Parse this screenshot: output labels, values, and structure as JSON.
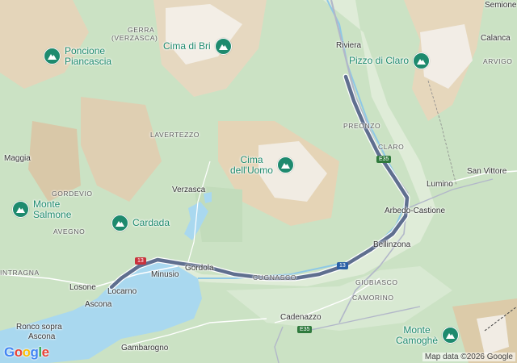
{
  "map": {
    "places": {
      "gerra": "GERRA",
      "gerra_sub": "(VERZASCA)",
      "riviera": "Riviera",
      "calanca": "Calanca",
      "arvigo": "ARVIGO",
      "lavertezzo": "LAVERTEZZO",
      "preonzo": "PREONZO",
      "claro": "CLARO",
      "maggia": "Maggia",
      "gordevio": "GORDEVIO",
      "verzasca": "Verzasca",
      "lumino": "Lumino",
      "san_vittore": "San Vittore",
      "arbedo": "Arbedo-Castione",
      "avegno": "AVEGNO",
      "bellinzona": "Bellinzona",
      "intragna": "INTRAGNA",
      "minusio": "Minusio",
      "gordola": "Gordola",
      "cugnasco": "CUGNASCO",
      "losone": "Losone",
      "locarno": "Locarno",
      "giubiasco": "GIUBIASCO",
      "ascona": "Ascona",
      "camorino": "CAMORINO",
      "cadenazzo": "Cadenazzo",
      "ronco1": "Ronco sopra",
      "ronco2": "Ascona",
      "gambarogno": "Gambarogno",
      "top_right": "Semione"
    },
    "peaks": {
      "ponciana1": "Poncione",
      "ponciana2": "Piancascia",
      "cima_bri": "Cima di Bri",
      "pizzo_claro": "Pizzo di Claro",
      "cima_uomo1": "Cima",
      "cima_uomo2": "dell'Uomo",
      "salmone1": "Monte",
      "salmone2": "Salmone",
      "cardada": "Cardada",
      "camoghe1": "Monte",
      "camoghe2": "Camoghè"
    },
    "shields": {
      "e35_north": "E35",
      "e35_south": "E35",
      "r13_west": "13",
      "r13_east": "13"
    },
    "colors": {
      "route": "#5f6f8f",
      "water": "#a9d8ef",
      "forest": "#c7e0c0",
      "rock": "#e7d7bd",
      "peak_poi": "#1e8a6e"
    }
  },
  "attribution": "Map data ©2026 Google",
  "logo": {
    "g1": "G",
    "o1": "o",
    "o2": "o",
    "g2": "g",
    "l": "l",
    "e": "e"
  }
}
